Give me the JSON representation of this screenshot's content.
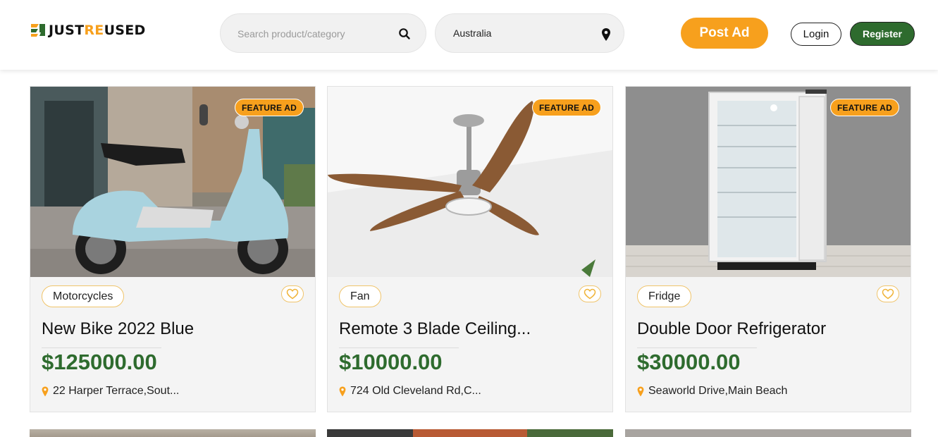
{
  "brand": {
    "name_part1": "JUST",
    "name_part2": "RE",
    "name_part3": "USED"
  },
  "search": {
    "placeholder": "Search product/category",
    "icon": "search-icon"
  },
  "location": {
    "value": "Australia",
    "icon": "map-pin-icon"
  },
  "actions": {
    "post_ad": "Post Ad",
    "login": "Login",
    "register": "Register"
  },
  "colors": {
    "accent": "#f7a01d",
    "brand_green": "#2e6b2e"
  },
  "listings": [
    {
      "badge": "FEATURE AD",
      "category": "Motorcycles",
      "title": "New Bike 2022 Blue",
      "price": "$125000.00",
      "address": "22 Harper Terrace,Sout..."
    },
    {
      "badge": "FEATURE AD",
      "category": "Fan",
      "title": "Remote 3 Blade Ceiling...",
      "price": "$10000.00",
      "address": "724 Old Cleveland Rd,C..."
    },
    {
      "badge": "FEATURE AD",
      "category": "Fridge",
      "title": "Double Door Refrigerator",
      "price": "$30000.00",
      "address": "Seaworld Drive,Main Beach"
    }
  ]
}
